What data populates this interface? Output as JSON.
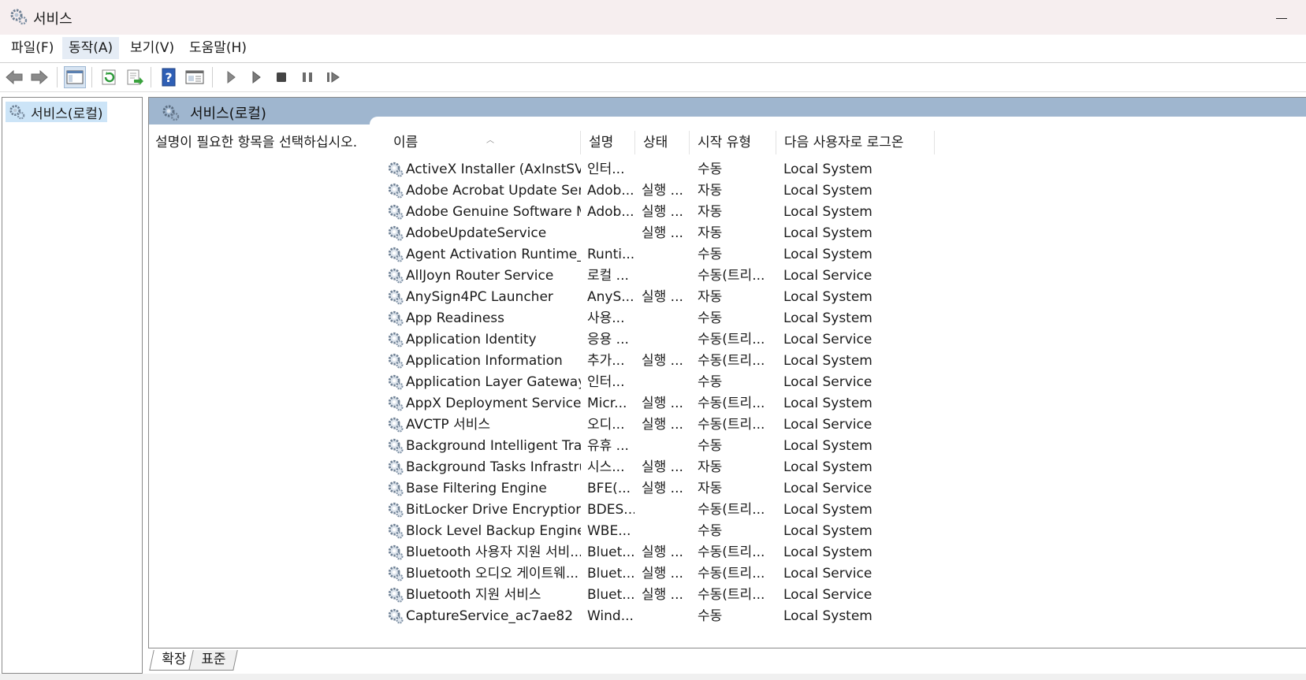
{
  "window": {
    "title": "서비스"
  },
  "menu": [
    {
      "label": "파일(F)",
      "active": false
    },
    {
      "label": "동작(A)",
      "active": true
    },
    {
      "label": "보기(V)",
      "active": false
    },
    {
      "label": "도움말(H)",
      "active": false
    }
  ],
  "toolbar": {
    "buttons": [
      "back-arrow-icon",
      "forward-arrow-icon",
      "show-hide-tree-icon",
      "refresh-icon",
      "export-list-icon",
      "help-icon",
      "properties-icon",
      "start-service-icon",
      "start-service-alt-icon",
      "stop-service-icon",
      "pause-service-icon",
      "resume-service-icon"
    ]
  },
  "tree": {
    "item_label": "서비스(로컬)"
  },
  "content": {
    "header_title": "서비스(로컬)",
    "description_prompt": "설명이 필요한 항목을 선택하십시오."
  },
  "table": {
    "columns": [
      "이름",
      "설명",
      "상태",
      "시작 유형",
      "다음 사용자로 로그온"
    ],
    "rows": [
      [
        "ActiveX Installer (AxInstSV)",
        "인터...",
        "",
        "수동",
        "Local System"
      ],
      [
        "Adobe Acrobat Update Serv...",
        "Adob...",
        "실행 ...",
        "자동",
        "Local System"
      ],
      [
        "Adobe Genuine Software M...",
        "Adob...",
        "실행 ...",
        "자동",
        "Local System"
      ],
      [
        "AdobeUpdateService",
        "",
        "실행 ...",
        "자동",
        "Local System"
      ],
      [
        "Agent Activation Runtime_a...",
        "Runti...",
        "",
        "수동",
        "Local System"
      ],
      [
        "AllJoyn Router Service",
        "로컬 ...",
        "",
        "수동(트리...",
        "Local Service"
      ],
      [
        "AnySign4PC Launcher",
        "AnyS...",
        "실행 ...",
        "자동",
        "Local System"
      ],
      [
        "App Readiness",
        "사용...",
        "",
        "수동",
        "Local System"
      ],
      [
        "Application Identity",
        "응용 ...",
        "",
        "수동(트리...",
        "Local Service"
      ],
      [
        "Application Information",
        "추가...",
        "실행 ...",
        "수동(트리...",
        "Local System"
      ],
      [
        "Application Layer Gateway ...",
        "인터...",
        "",
        "수동",
        "Local Service"
      ],
      [
        "AppX Deployment Service (...",
        "Micr...",
        "실행 ...",
        "수동(트리...",
        "Local System"
      ],
      [
        "AVCTP 서비스",
        "오디...",
        "실행 ...",
        "수동(트리...",
        "Local Service"
      ],
      [
        "Background Intelligent Tran...",
        "유휴 ...",
        "",
        "수동",
        "Local System"
      ],
      [
        "Background Tasks Infrastruc...",
        "시스...",
        "실행 ...",
        "자동",
        "Local System"
      ],
      [
        "Base Filtering Engine",
        "BFE(...",
        "실행 ...",
        "자동",
        "Local Service"
      ],
      [
        "BitLocker Drive Encryption ...",
        "BDES...",
        "",
        "수동(트리...",
        "Local System"
      ],
      [
        "Block Level Backup Engine ...",
        "WBE...",
        "",
        "수동",
        "Local System"
      ],
      [
        "Bluetooth 사용자 지원 서비...",
        "Bluet...",
        "실행 ...",
        "수동(트리...",
        "Local System"
      ],
      [
        "Bluetooth 오디오 게이트웨...",
        "Bluet...",
        "실행 ...",
        "수동(트리...",
        "Local Service"
      ],
      [
        "Bluetooth 지원 서비스",
        "Bluet...",
        "실행 ...",
        "수동(트리...",
        "Local Service"
      ],
      [
        "CaptureService_ac7ae82",
        "Wind...",
        "",
        "수동",
        "Local System"
      ]
    ]
  },
  "tabs": [
    "확장",
    "표준"
  ]
}
